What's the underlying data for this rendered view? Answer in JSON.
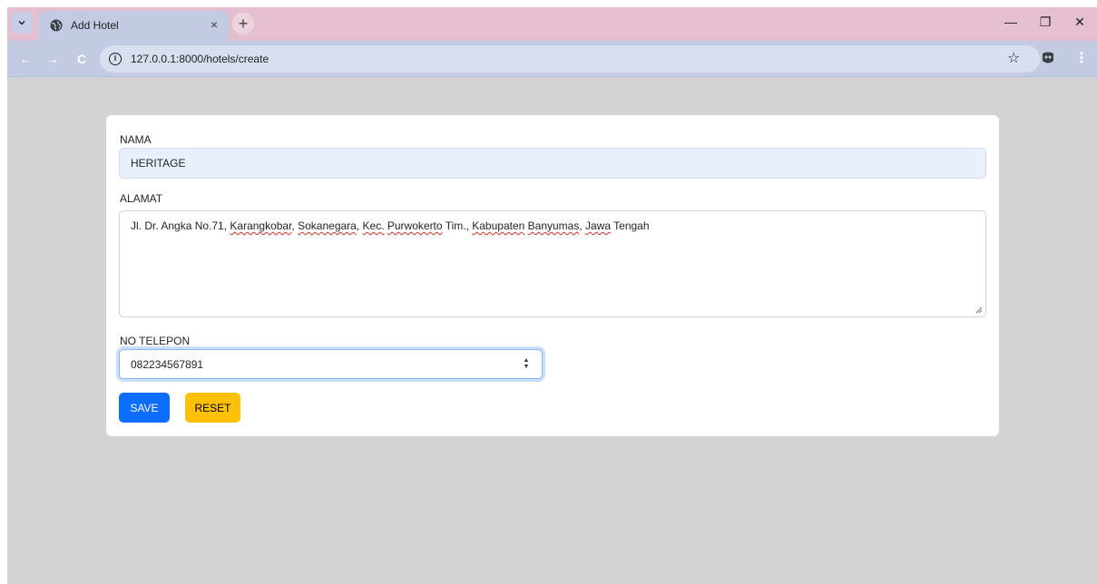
{
  "browser": {
    "tab_title": "Add Hotel",
    "tab_close_glyph": "×",
    "new_tab_glyph": "+",
    "url": "127.0.0.1:8000/hotels/create",
    "window_controls": {
      "minimize": "—",
      "restore": "❐",
      "close": "✕"
    },
    "nav": {
      "back": "←",
      "forward": "→",
      "reload": "C"
    },
    "bookmark_glyph": "☆",
    "menu_glyph": "⋮",
    "icons": [
      "tab-search-icon",
      "globe-icon",
      "info-icon",
      "star-icon",
      "extension-icon",
      "menu-icon"
    ]
  },
  "form": {
    "nama_label": "NAMA",
    "nama_value": "HERITAGE",
    "alamat_label": "ALAMAT",
    "alamat_parts": [
      "Jl. Dr. Angka No.71, ",
      "Karangkobar",
      ", ",
      "Sokanegara",
      ", ",
      "Kec.",
      " ",
      "Purwokerto",
      " Tim., ",
      "Kabupaten",
      " ",
      "Banyumas",
      ", ",
      "Jawa",
      " Tengah"
    ],
    "telepon_label": "NO TELEPON",
    "telepon_value": "082234567891",
    "save_label": "SAVE",
    "reset_label": "RESET"
  },
  "colors": {
    "tabstrip": "#e3bfd0",
    "toolbar": "#c3cbe2",
    "page_bg": "#d3d3d3",
    "save_button": "#0d6efd",
    "reset_button": "#ffc107",
    "autofill_bg": "#e8f0fe"
  }
}
